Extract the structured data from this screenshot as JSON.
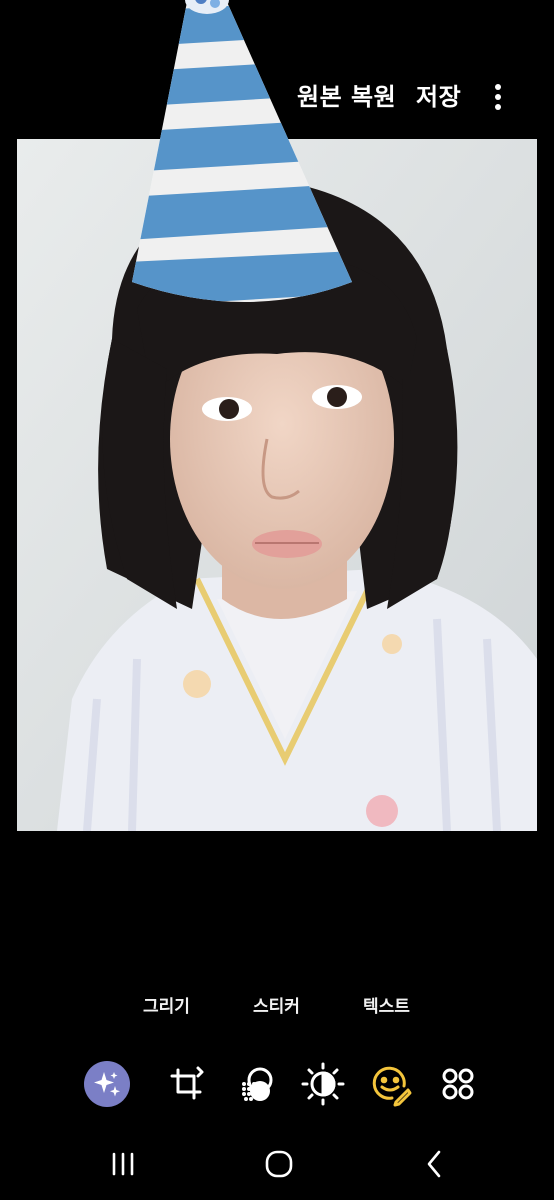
{
  "header": {
    "revert_label": "원본 복원",
    "save_label": "저장",
    "more_icon": "more-vertical-icon"
  },
  "photo": {
    "sticker": "party-hat-sticker",
    "hat_colors": [
      "#5aa0d8",
      "#ffffff"
    ],
    "background_color": "#000000"
  },
  "subtabs": {
    "draw_label": "그리기",
    "sticker_label": "스티커",
    "text_label": "텍스트"
  },
  "toolbar": {
    "tools": [
      {
        "name": "ai-edit-icon",
        "active": true
      },
      {
        "name": "crop-rotate-icon",
        "active": false
      },
      {
        "name": "filter-icon",
        "active": false
      },
      {
        "name": "brightness-icon",
        "active": false
      },
      {
        "name": "decorate-emoji-icon",
        "active": true
      },
      {
        "name": "more-tools-icon",
        "active": false
      }
    ],
    "active_color": "#f4c53c",
    "ai_button_color": "#7b7fc6"
  },
  "navbar": {
    "buttons": [
      "recent-apps-icon",
      "home-icon",
      "back-icon"
    ]
  }
}
